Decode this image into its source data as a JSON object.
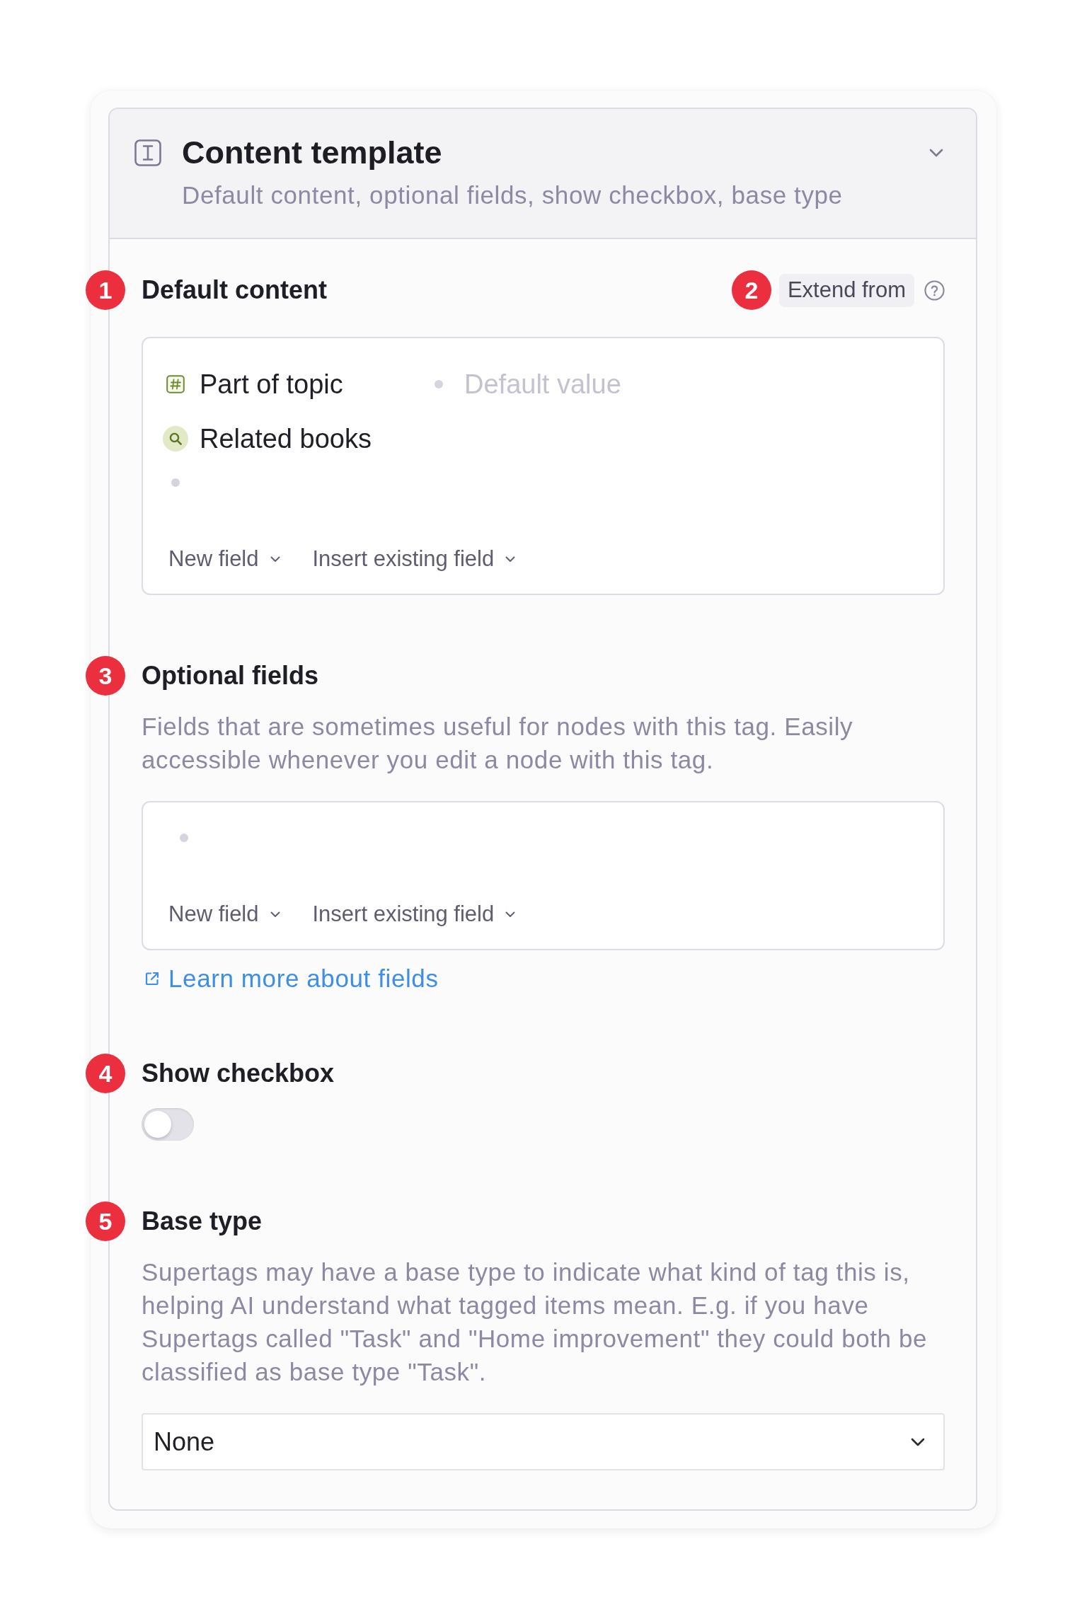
{
  "panel": {
    "title": "Content template",
    "subtitle": "Default content, optional fields, show checkbox, base type"
  },
  "sections": [
    {
      "kind": "fields",
      "marker": "1",
      "heading": "Default content",
      "extend": {
        "label": "Extend from",
        "marker": "2"
      },
      "rows": [
        {
          "kind": "tag",
          "name": "Part of topic",
          "placeholder": "Default value"
        },
        {
          "kind": "search",
          "name": "Related books"
        },
        {
          "kind": "bullet"
        }
      ],
      "actions": [
        "New field",
        "Insert existing field"
      ]
    },
    {
      "kind": "fields",
      "marker": "3",
      "heading": "Optional fields",
      "description": "Fields that are sometimes useful for nodes with this tag. Easily accessible whenever you edit a node with this tag.",
      "rows": [
        {
          "kind": "bullet"
        }
      ],
      "actions": [
        "New field",
        "Insert existing field"
      ],
      "link": "Learn more about fields"
    },
    {
      "kind": "toggle",
      "marker": "4",
      "heading": "Show checkbox",
      "on": false
    },
    {
      "kind": "select",
      "marker": "5",
      "heading": "Base type",
      "description": "Supertags may have a base type to indicate what kind of tag this is, helping AI understand what tagged items mean. E.g. if you have Supertags called \"Task\" and \"Home improvement\" they could both be classified as base type \"Task\".",
      "value": "None"
    }
  ]
}
